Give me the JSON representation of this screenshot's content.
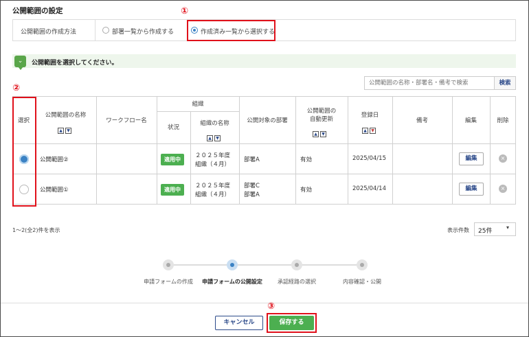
{
  "section_title": "公開範囲の設定",
  "method": {
    "label": "公開範囲の作成方法",
    "option1": "部署一覧から作成する",
    "option2": "作成済み一覧から選択する"
  },
  "annotations": {
    "one": "①",
    "two": "②",
    "three": "③"
  },
  "banner": {
    "icon": "chevron-down-icon",
    "text": "公開範囲を選択してください。"
  },
  "search": {
    "placeholder": "公開範囲の名称・部署名・備考で検索",
    "button": "検索"
  },
  "table": {
    "headers": {
      "select": "選択",
      "name": "公開範囲の名称",
      "workflow": "ワークフロー名",
      "org": "組織",
      "status": "状況",
      "org_name": "組織の名称",
      "target_dept": "公開対象の部署",
      "auto_update_1": "公開範囲の",
      "auto_update_2": "自動更新",
      "registered": "登録日",
      "remarks": "備考",
      "edit": "編集",
      "delete": "削除"
    },
    "rows": [
      {
        "selected": true,
        "name": "公開範囲②",
        "workflow": "",
        "status": "適用中",
        "org_line1": "２０２５年度",
        "org_line2": "組織（４月）",
        "dept_line1": "部署A",
        "dept_line2": "",
        "auto_update": "有効",
        "date": "2025/04/15",
        "remarks": "",
        "edit": "編集"
      },
      {
        "selected": false,
        "name": "公開範囲①",
        "workflow": "",
        "status": "適用中",
        "org_line1": "２０２５年度",
        "org_line2": "組織（４月）",
        "dept_line1": "部署C",
        "dept_line2": "部署A",
        "auto_update": "有効",
        "date": "2025/04/14",
        "remarks": "",
        "edit": "編集"
      }
    ]
  },
  "pagination": {
    "count_text": "1〜2(全2)件を表示",
    "per_page_label": "表示件数",
    "per_page_value": "25件"
  },
  "steps": [
    {
      "label": "申請フォームの作成",
      "active": false
    },
    {
      "label": "申請フォームの公開設定",
      "active": true
    },
    {
      "label": "承認経路の選択",
      "active": false
    },
    {
      "label": "内容確認・公開",
      "active": false
    }
  ],
  "buttons": {
    "cancel": "キャンセル",
    "save": "保存する"
  },
  "colors": {
    "accent": "#3b82c4",
    "green": "#4caf50",
    "annotation_red": "#e0101a",
    "navy": "#2c4a8a"
  }
}
